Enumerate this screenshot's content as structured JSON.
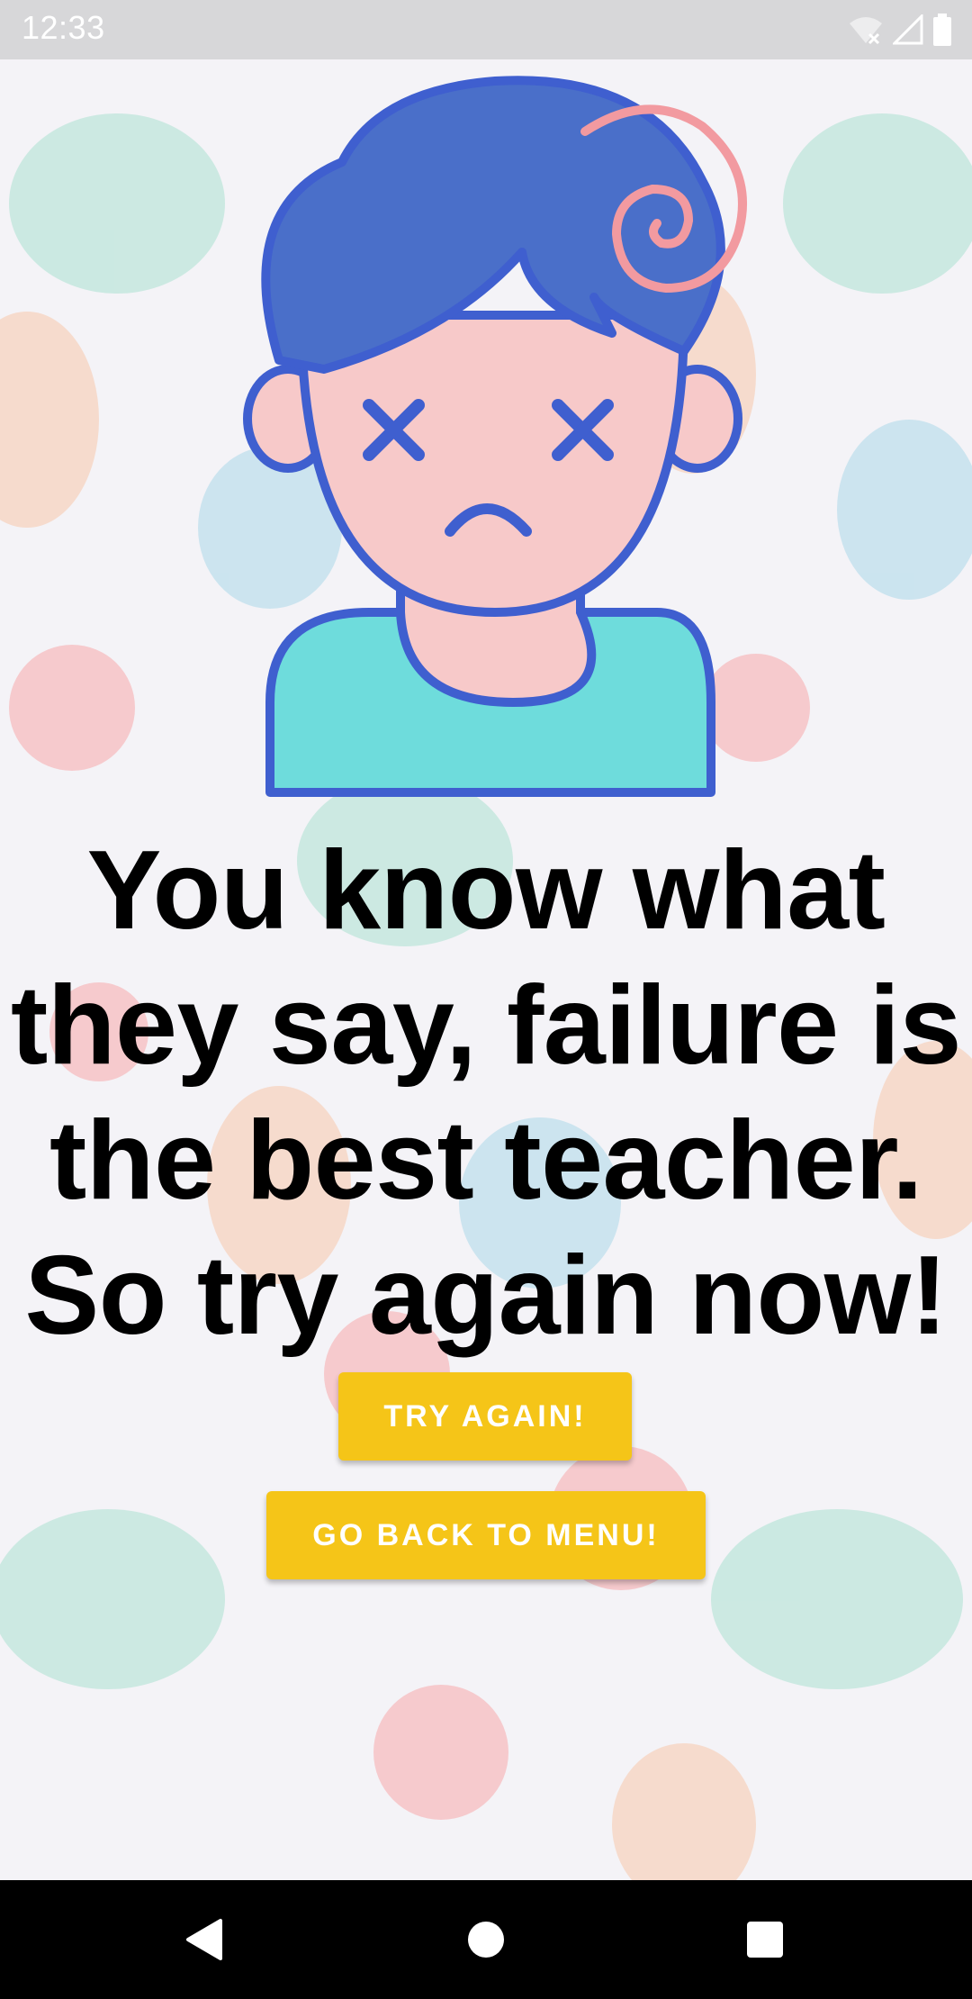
{
  "status_bar": {
    "time": "12:33",
    "icons": [
      "wifi-off-icon",
      "signal-icon",
      "battery-icon"
    ]
  },
  "illustration": {
    "name": "dizzy-sad-boy-illustration"
  },
  "message": {
    "lines": [
      "You know what",
      "they say, failure is",
      "the best teacher.",
      "So try again now!"
    ]
  },
  "buttons": {
    "try_again": "TRY AGAIN!",
    "back_to_menu": "GO BACK TO MENU!"
  },
  "nav_bar": {
    "icons": [
      "back-icon",
      "home-icon",
      "recents-icon"
    ]
  },
  "colors": {
    "button_bg": "#f5c518",
    "button_text": "#ffffff",
    "hair": "#4a6fc9",
    "face": "#f7c9c9",
    "shirt": "#6edcdc",
    "outline": "#3f5fcf",
    "spiral": "#f29aa0"
  }
}
